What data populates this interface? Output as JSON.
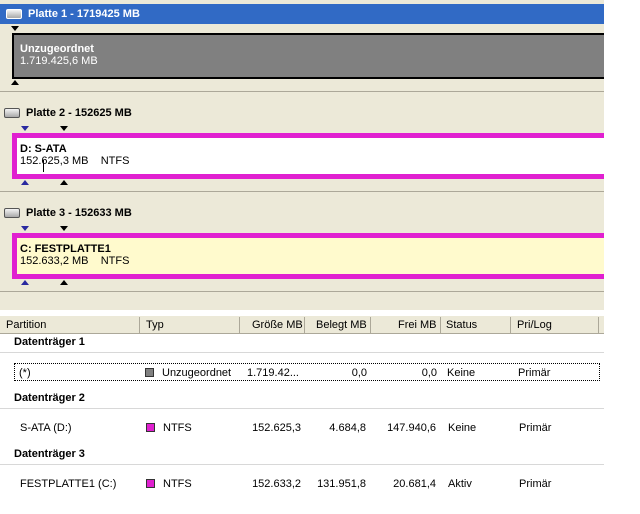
{
  "disks": [
    {
      "header": "Platte 1 - 1719425 MB",
      "partition": {
        "name": "Unzugeordnet",
        "size": "1.719.425,6 MB",
        "fs": ""
      }
    },
    {
      "header": "Platte 2 - 152625 MB",
      "partition": {
        "name": "D:  S-ATA",
        "size": "152.625,3 MB",
        "fs": "NTFS"
      }
    },
    {
      "header": "Platte 3 - 152633 MB",
      "partition": {
        "name": "C:  FESTPLATTE1",
        "size": "152.633,2 MB",
        "fs": "NTFS"
      }
    }
  ],
  "table": {
    "columns": [
      "Partition",
      "Typ",
      "Größe MB",
      "Belegt MB",
      "Frei MB",
      "Status",
      "Pri/Log"
    ],
    "groups": [
      {
        "title": "Datenträger 1",
        "rows": [
          {
            "partition": "(*)",
            "type": "Unzugeordnet",
            "type_color": "#808080",
            "size": "1.719.42...",
            "used": "0,0",
            "free": "0,0",
            "status": "Keine",
            "prilog": "Primär"
          }
        ]
      },
      {
        "title": "Datenträger 2",
        "rows": [
          {
            "partition": "S-ATA (D:)",
            "type": "NTFS",
            "type_color": "#e020d0",
            "size": "152.625,3",
            "used": "4.684,8",
            "free": "147.940,6",
            "status": "Keine",
            "prilog": "Primär"
          }
        ]
      },
      {
        "title": "Datenträger 3",
        "rows": [
          {
            "partition": "FESTPLATTE1 (C:)",
            "type": "NTFS",
            "type_color": "#e020d0",
            "size": "152.633,2",
            "used": "131.951,8",
            "free": "20.681,4",
            "status": "Aktiv",
            "prilog": "Primär"
          }
        ]
      }
    ]
  },
  "colors": {
    "selection": "#316ac5",
    "ntfs": "#e020d0",
    "unallocated": "#808080",
    "highlight": "#fffacd"
  }
}
